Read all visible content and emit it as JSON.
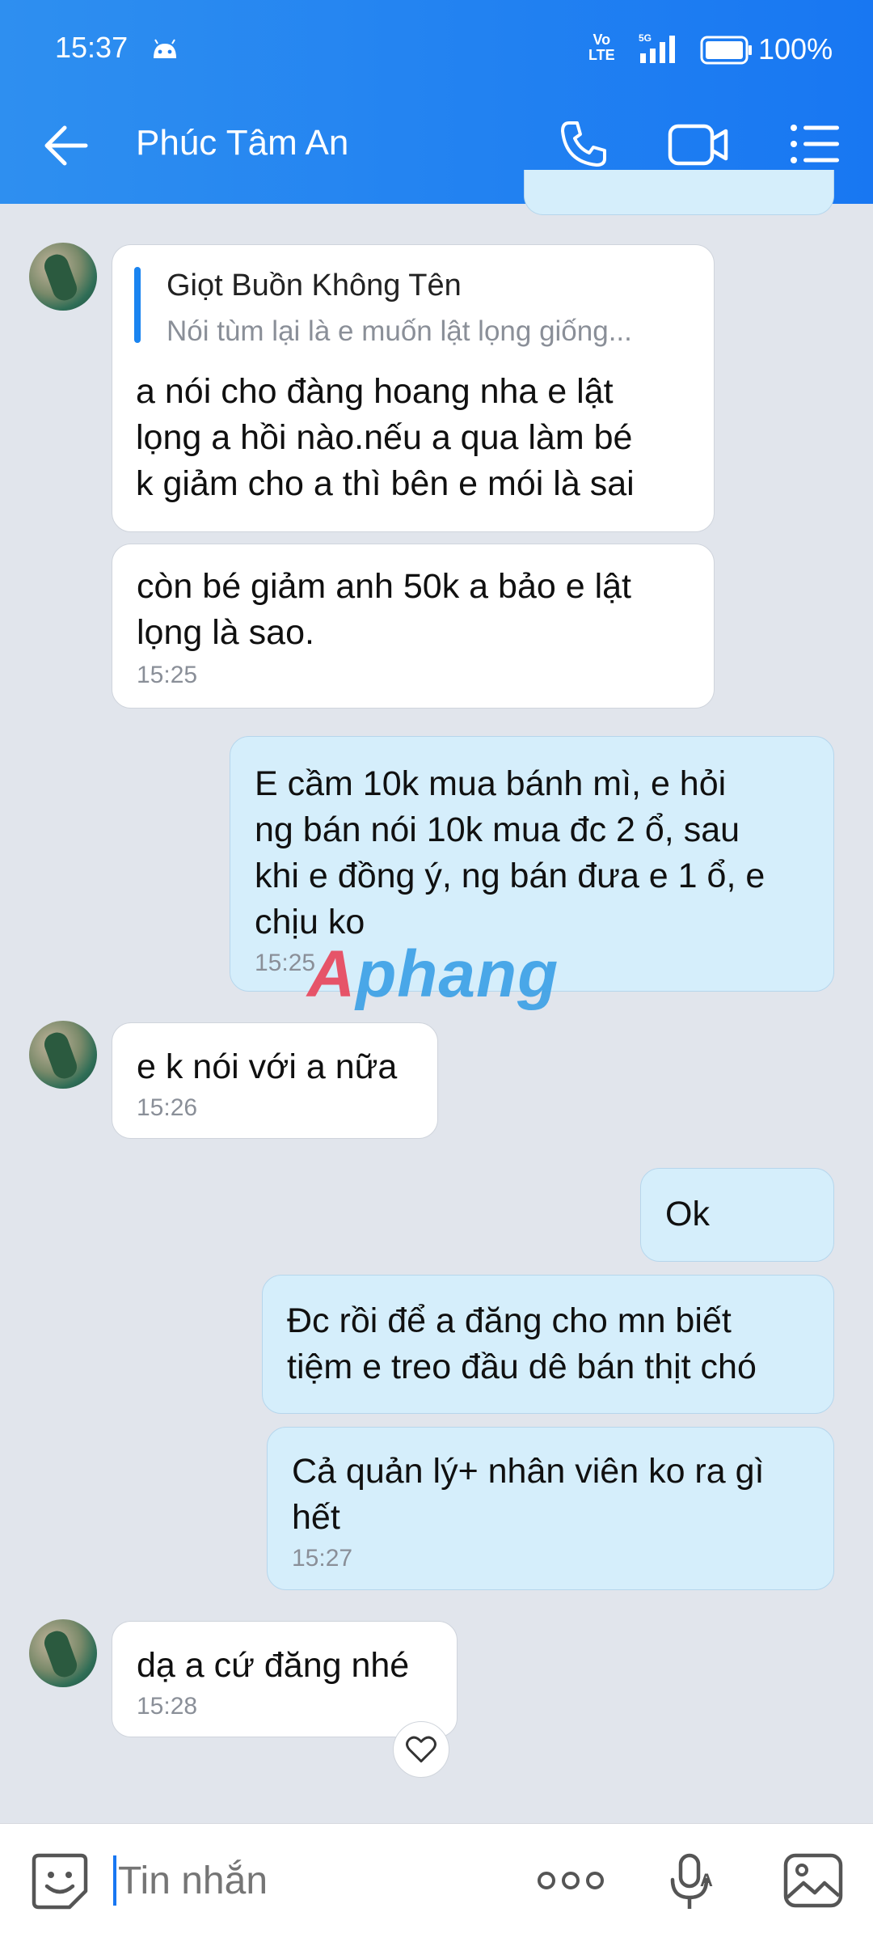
{
  "status_bar": {
    "time": "15:37",
    "network_volte_1": "Vo",
    "network_volte_2": "LTE",
    "network_5g": "5G",
    "battery": "100%"
  },
  "header": {
    "title": "Phúc Tâm An"
  },
  "messages": [
    {
      "sender": "other",
      "quote_name": "Giọt Buồn Không Tên",
      "quote_text": "Nói tùm lại là e muốn lật lọng giống...",
      "lines": [
        "a nói cho đàng hoang nha e lật",
        "lọng a hồi nào.nếu a qua làm bé",
        "k giảm cho a thì bên e mói là sai"
      ]
    },
    {
      "sender": "other",
      "lines": [
        "còn bé giảm anh 50k a bảo e lật",
        "lọng là sao."
      ],
      "time": "15:25"
    },
    {
      "sender": "me",
      "lines": [
        "E cầm 10k mua bánh mì, e hỏi",
        "ng bán nói 10k mua đc 2 ổ, sau",
        "khi e đồng ý, ng bán đưa e 1 ổ, e",
        "chịu ko"
      ],
      "time": "15:25"
    },
    {
      "sender": "other",
      "lines": [
        "e k nói với a nữa"
      ],
      "time": "15:26"
    },
    {
      "sender": "me",
      "lines": [
        "Ok"
      ]
    },
    {
      "sender": "me",
      "lines": [
        "Đc rồi để a đăng cho mn biết",
        "tiệm e treo đầu dê bán thịt chó"
      ]
    },
    {
      "sender": "me",
      "lines": [
        "Cả quản lý+ nhân viên ko ra gì",
        "hết"
      ],
      "time": "15:27"
    },
    {
      "sender": "other",
      "lines": [
        "dạ a cứ đăng nhé"
      ],
      "time": "15:28"
    }
  ],
  "watermark": {
    "a": "A",
    "rest": "phang"
  },
  "input": {
    "placeholder": "Tin nhắn"
  },
  "icons": {
    "back": "back-arrow-icon",
    "call": "phone-icon",
    "video": "video-camera-icon",
    "menu": "list-menu-icon",
    "sticker": "sticker-smile-icon",
    "more": "more-dots-icon",
    "mic": "microphone-icon",
    "image": "image-gallery-icon",
    "heart": "heart-icon"
  },
  "colors": {
    "header": "#1877f2",
    "my_bubble": "#d5eefb",
    "other_bubble": "#ffffff",
    "background": "#e1e5ec"
  }
}
